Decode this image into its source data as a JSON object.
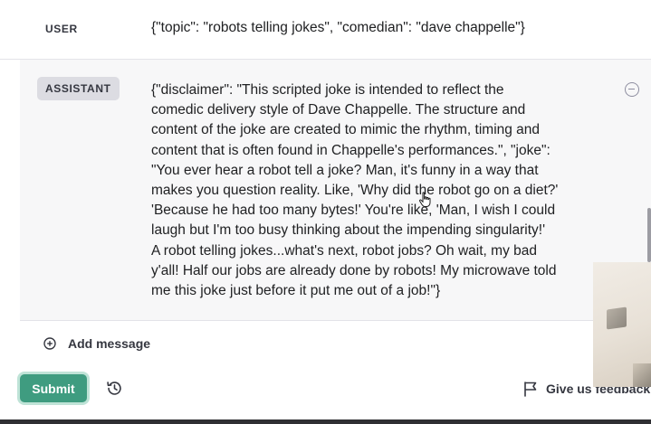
{
  "user_row": {
    "role": "USER",
    "message": "{\"topic\": \"robots telling jokes\", \"comedian\": \"dave chappelle\"}"
  },
  "assistant_row": {
    "role": "ASSISTANT",
    "message_lines": [
      "{\"disclaimer\": \"This scripted joke is intended to reflect the",
      "comedic delivery style of Dave Chappelle. The structure and",
      "content of the joke are created to mimic the rhythm, timing and",
      "content that is often found in Chappelle's performances.\", \"joke\":",
      "\"You ever hear a robot tell a joke? Man, it's funny in a way that",
      "makes you question reality. Like, 'Why did the robot go on a diet?'",
      "'Because he had too many bytes!' You're like, 'Man, I wish I could",
      "laugh but I'm too busy thinking about the impending singularity!'",
      "A robot telling jokes...what's next, robot jobs? Oh wait, my bad",
      "y'all! Half our jobs are already done by robots! My microwave told",
      "me this joke just before it put me out of a job!\"}"
    ]
  },
  "actions": {
    "add_message": "Add message",
    "submit": "Submit",
    "feedback": "Give us feedback"
  },
  "icons": {
    "remove": "minus-circle-icon",
    "add": "plus-circle-icon",
    "history": "history-icon",
    "feedback": "flag-icon",
    "cursor": "hand-pointer-icon"
  },
  "colors": {
    "accent": "#3f9c80",
    "assistant_bg": "#f7f7f8",
    "role_badge_bg": "#dcdce2",
    "text": "#202123"
  }
}
